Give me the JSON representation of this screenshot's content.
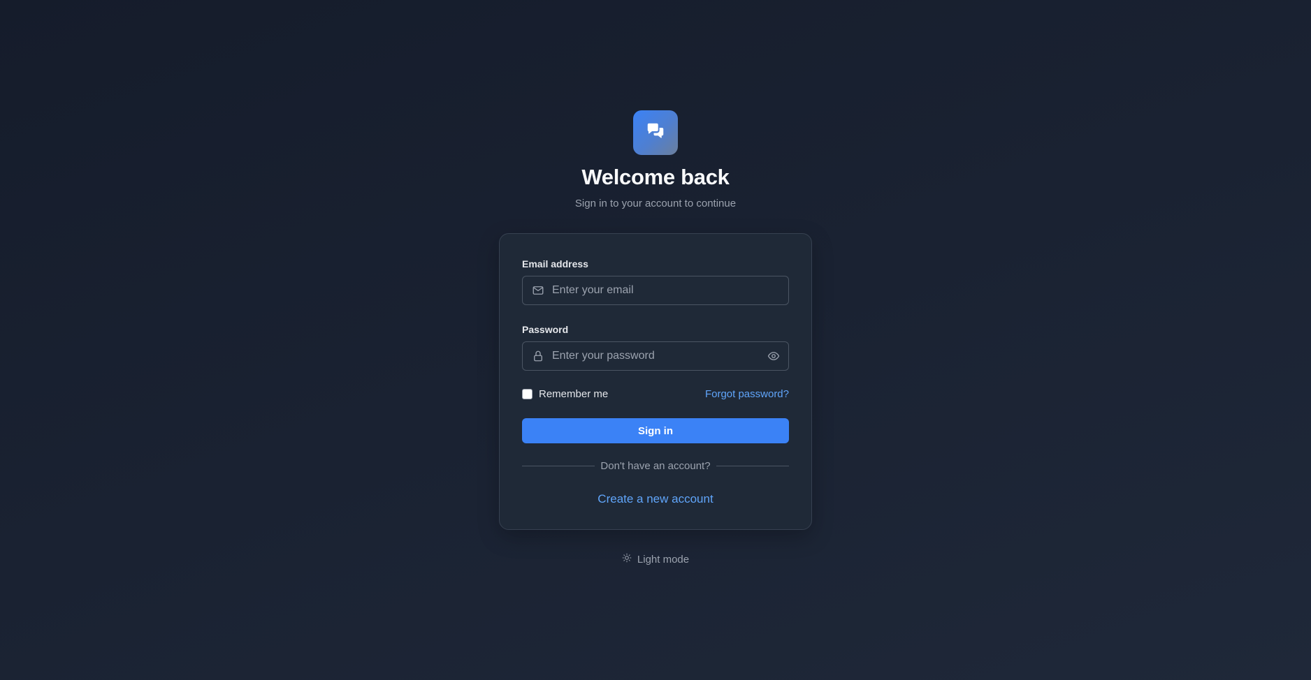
{
  "header": {
    "logo_icon": "chat-bubbles-icon",
    "title": "Welcome back",
    "subtitle": "Sign in to your account to continue"
  },
  "form": {
    "email": {
      "label": "Email address",
      "placeholder": "Enter your email",
      "value": "",
      "icon": "mail-icon"
    },
    "password": {
      "label": "Password",
      "placeholder": "Enter your password",
      "value": "",
      "icon": "lock-icon",
      "toggle_icon": "eye-icon"
    },
    "remember_label": "Remember me",
    "remember_checked": false,
    "forgot_label": "Forgot password?",
    "submit_label": "Sign in",
    "divider_text": "Don't have an account?",
    "create_label": "Create a new account"
  },
  "footer": {
    "theme_toggle_label": "Light mode",
    "theme_toggle_icon": "sun-icon"
  },
  "colors": {
    "background": "#1a2232",
    "card": "#1f2937",
    "accent": "#3b82f6",
    "link": "#60a5fa"
  }
}
